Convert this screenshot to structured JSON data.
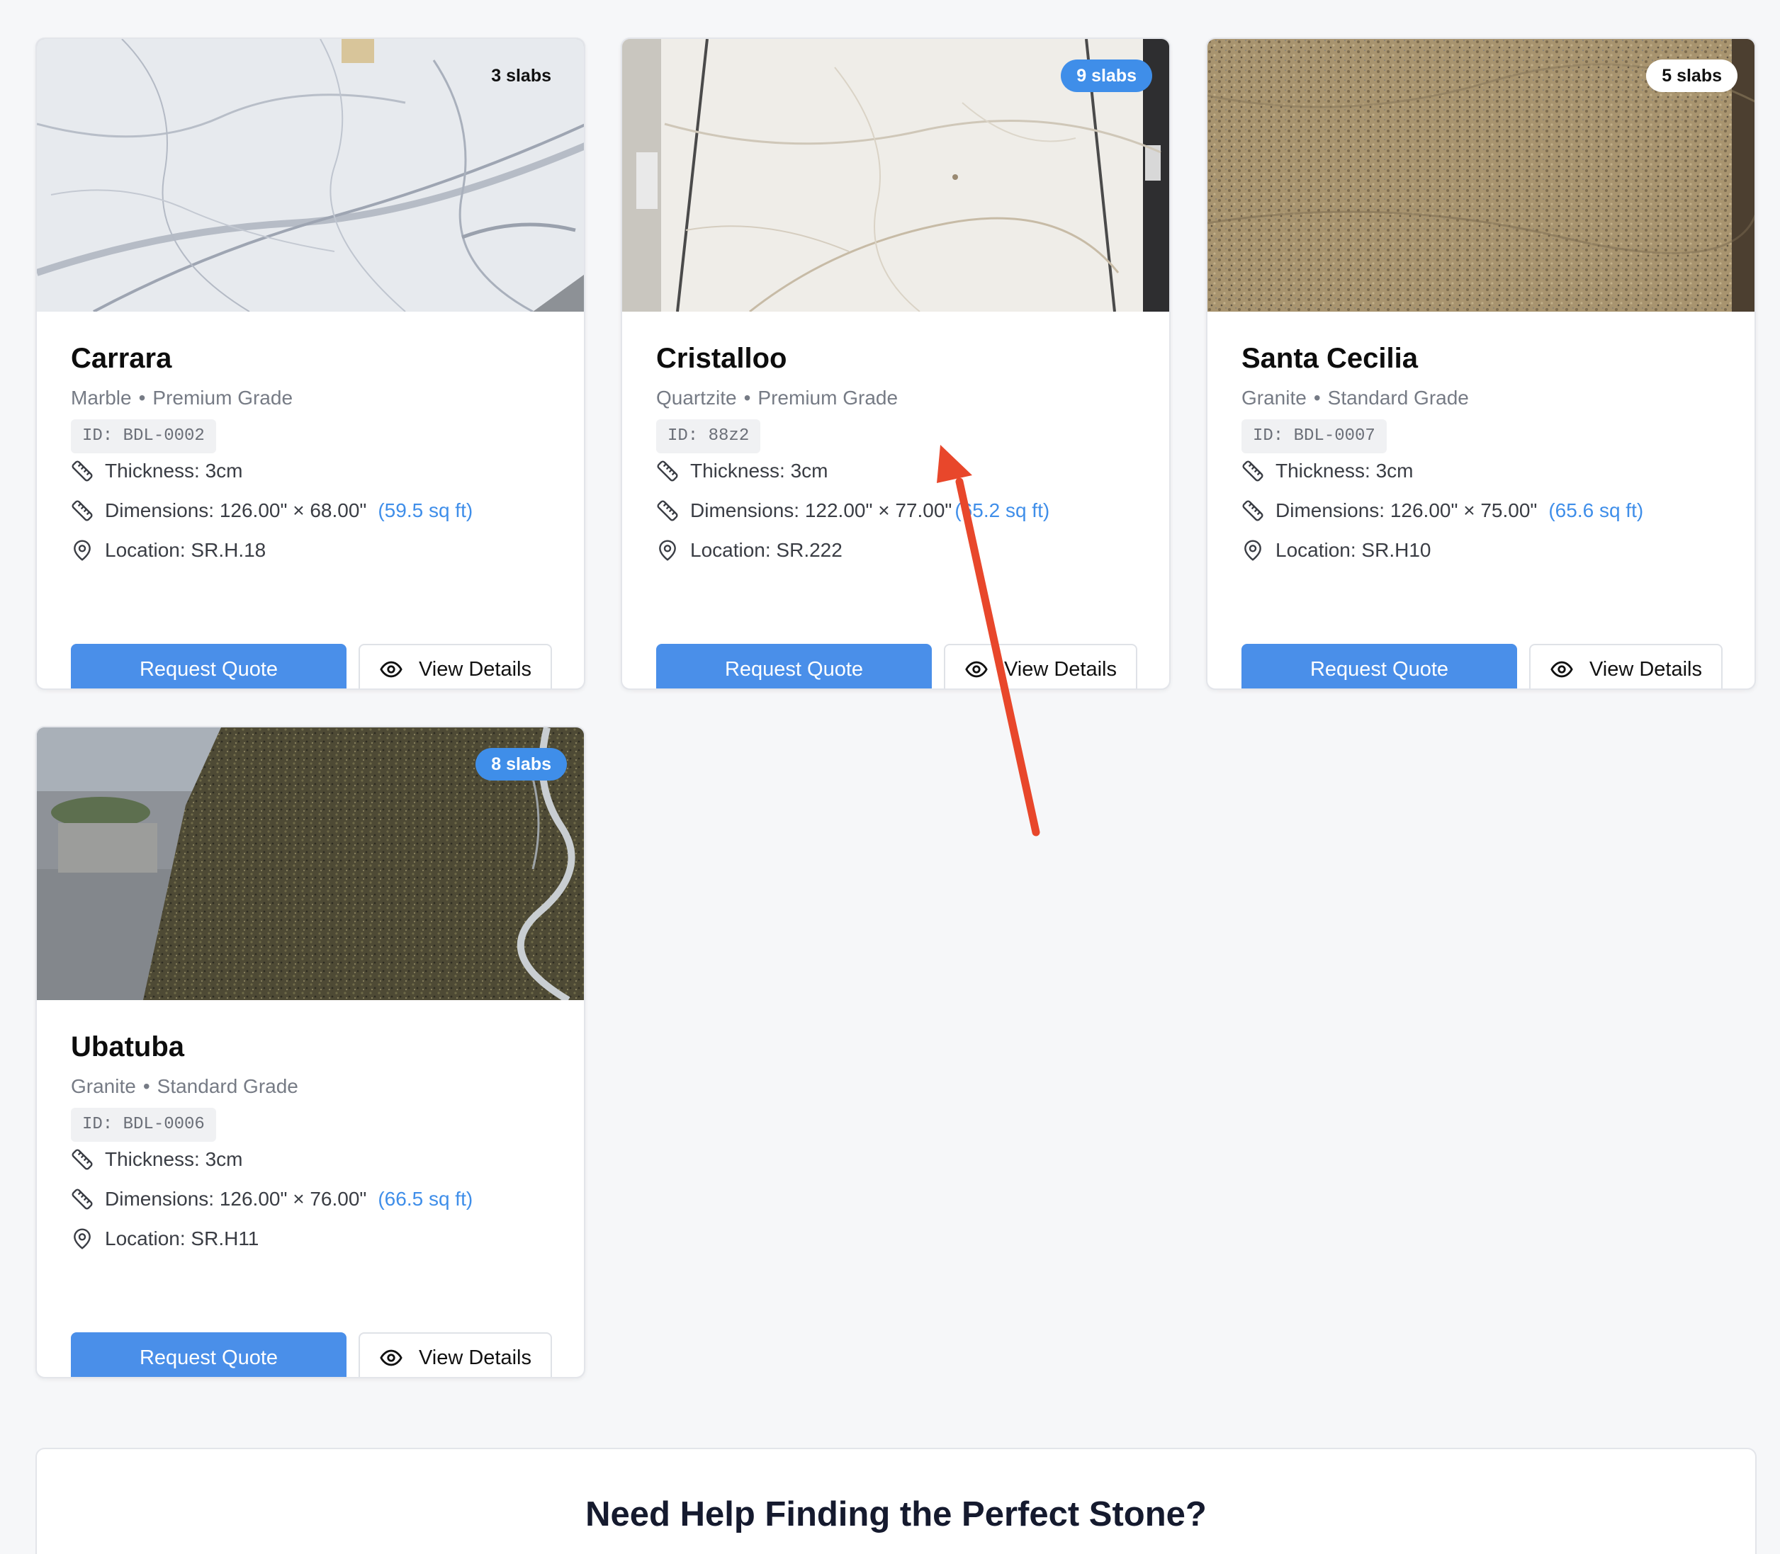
{
  "products": [
    {
      "name": "Carrara",
      "material": "Marble",
      "grade": "Premium Grade",
      "id_label": "ID: BDL-0002",
      "slabs": "3 slabs",
      "badge_style": "white",
      "thickness": "Thickness: 3cm",
      "dimensions": "Dimensions: 126.00\" × 68.00\"",
      "sqft": "(59.5 sq ft)",
      "location": "Location: SR.H.18",
      "quote_label": "Request Quote",
      "details_label": "View Details"
    },
    {
      "name": "Cristalloo",
      "material": "Quartzite",
      "grade": "Premium Grade",
      "id_label": "ID: 88z2",
      "slabs": "9 slabs",
      "badge_style": "blue",
      "thickness": "Thickness: 3cm",
      "dimensions": "Dimensions: 122.00\" × 77.00\"",
      "sqft": "(65.2 sq ft)",
      "location": "Location: SR.222",
      "quote_label": "Request Quote",
      "details_label": "View Details"
    },
    {
      "name": "Santa Cecilia",
      "material": "Granite",
      "grade": "Standard Grade",
      "id_label": "ID: BDL-0007",
      "slabs": "5 slabs",
      "badge_style": "white",
      "thickness": "Thickness: 3cm",
      "dimensions": "Dimensions: 126.00\" × 75.00\"",
      "sqft": "(65.6 sq ft)",
      "location": "Location: SR.H10",
      "quote_label": "Request Quote",
      "details_label": "View Details"
    },
    {
      "name": "Ubatuba",
      "material": "Granite",
      "grade": "Standard Grade",
      "id_label": "ID: BDL-0006",
      "slabs": "8 slabs",
      "badge_style": "blue",
      "thickness": "Thickness: 3cm",
      "dimensions": "Dimensions: 126.00\" × 76.00\"",
      "sqft": "(66.5 sq ft)",
      "location": "Location: SR.H11",
      "quote_label": "Request Quote",
      "details_label": "View Details"
    }
  ],
  "separator": "•",
  "help": {
    "title": "Need Help Finding the Perfect Stone?"
  },
  "colors": {
    "accent": "#4a8fe9",
    "annotation_arrow": "#e8472b",
    "page_background": "#f6f7f9"
  },
  "icons": {
    "spec": "ruler-icon",
    "location": "map-pin-icon",
    "view": "eye-icon"
  }
}
